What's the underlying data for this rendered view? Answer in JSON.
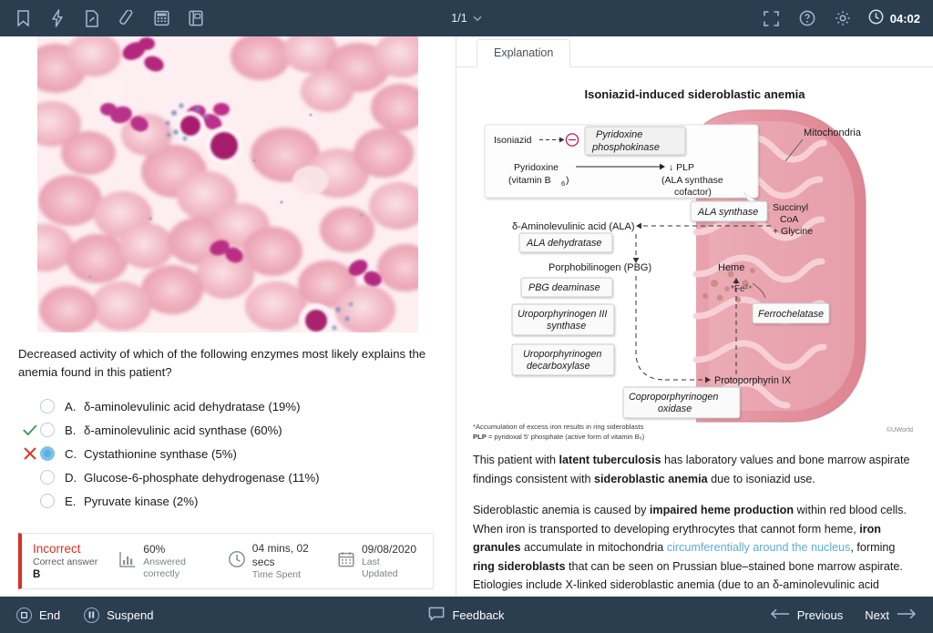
{
  "topbar": {
    "tools": [
      {
        "name": "bookmark-icon",
        "label": "Bookmark"
      },
      {
        "name": "flash-icon",
        "label": "Flash"
      },
      {
        "name": "notes-icon",
        "label": "Notes"
      },
      {
        "name": "highlighter-icon",
        "label": "Highlighter"
      },
      {
        "name": "calculator-icon",
        "label": "Calculator"
      },
      {
        "name": "lab-values-icon",
        "label": "Lab Values"
      }
    ],
    "page_indicator": "1/1",
    "right_tools": [
      {
        "name": "fullscreen-icon",
        "label": "Fullscreen"
      },
      {
        "name": "help-icon",
        "label": "Help"
      },
      {
        "name": "settings-icon",
        "label": "Settings"
      }
    ],
    "timer": "04:02"
  },
  "question": {
    "stem": "Decreased activity of which of the following enzymes most likely explains the anemia found in this patient?",
    "choices": [
      {
        "letter": "A.",
        "text": "δ-aminolevulinic acid dehydratase (19%)",
        "selected": false,
        "mark": ""
      },
      {
        "letter": "B.",
        "text": "δ-aminolevulinic acid synthase (60%)",
        "selected": false,
        "mark": "check"
      },
      {
        "letter": "C.",
        "text": "Cystathionine synthase (5%)",
        "selected": true,
        "mark": "cross"
      },
      {
        "letter": "D.",
        "text": "Glucose-6-phosphate dehydrogenase (11%)",
        "selected": false,
        "mark": ""
      },
      {
        "letter": "E.",
        "text": "Pyruvate kinase (2%)",
        "selected": false,
        "mark": ""
      }
    ]
  },
  "results": {
    "status": "Incorrect",
    "correct_answer_label": "Correct answer",
    "correct_answer": "B",
    "stats": [
      {
        "icon": "bar-chart-icon",
        "value": "60%",
        "label": "Answered correctly"
      },
      {
        "icon": "clock-icon",
        "value": "04 mins, 02 secs",
        "label": "Time Spent"
      },
      {
        "icon": "calendar-icon",
        "value": "09/08/2020",
        "label": "Last Updated"
      }
    ]
  },
  "explanation_panel": {
    "tab_label": "Explanation",
    "figure": {
      "title": "Isoniazid-induced sideroblastic anemia",
      "inset": {
        "drug": "Isoniazid",
        "inhibited_enzyme": "Pyridoxine phosphokinase",
        "substrate": "Pyridoxine",
        "substrate_sub": "(vitamin B₆)",
        "product": "↓ PLP",
        "product_sub_1": "(ALA synthase",
        "product_sub_2": "cofactor)"
      },
      "cytosol_metabolites": [
        "δ-Aminolevulinic acid (ALA)",
        "Porphobilinogen (PBG)"
      ],
      "cytosol_enzymes": [
        "ALA dehydratase",
        "PBG deaminase",
        "Uroporphyrinogen III synthase",
        "Uroporphyrinogen decarboxylase",
        "Coproporphyrinogen oxidase"
      ],
      "mito_label": "Mitochondria",
      "mito_enzymes": [
        "ALA synthase",
        "Ferrochelatase"
      ],
      "mito_substrate_1": "Succinyl",
      "mito_substrate_2": "CoA",
      "mito_substrate_3": "+ Glycine",
      "mito_metabolites": [
        "Heme",
        "Protoporphyrin IX"
      ],
      "iron_label": "*Fe²⁺",
      "footnote_1": "*Accumulation of excess iron results in ring sideroblasts",
      "footnote_2_bold": "PLP",
      "footnote_2": " = pyridoxal 5' phosphate (active form of vitamin B₆)",
      "copyright": "©UWorld"
    },
    "paragraphs": [
      {
        "runs": [
          {
            "t": "This patient with ",
            "s": "n"
          },
          {
            "t": "latent tuberculosis",
            "s": "b"
          },
          {
            "t": " has laboratory values and bone marrow aspirate findings consistent with ",
            "s": "n"
          },
          {
            "t": "sideroblastic anemia",
            "s": "b"
          },
          {
            "t": " due to isoniazid use.",
            "s": "n"
          }
        ]
      },
      {
        "runs": [
          {
            "t": "Sideroblastic anemia is caused by ",
            "s": "n"
          },
          {
            "t": "impaired heme production",
            "s": "b"
          },
          {
            "t": " within red blood cells.  When iron is transported to developing erythrocytes that cannot form heme, ",
            "s": "n"
          },
          {
            "t": "iron granules",
            "s": "b"
          },
          {
            "t": " accumulate in mitochondria ",
            "s": "n"
          },
          {
            "t": "circumferentially around the nucleus",
            "s": "h"
          },
          {
            "t": ", forming ",
            "s": "n"
          },
          {
            "t": "ring sideroblasts",
            "s": "b"
          },
          {
            "t": " that can be seen on Prussian blue–stained bone marrow aspirate.  Etiologies include X-linked sideroblastic anemia (due to an δ-aminolevulinic acid synthase mutation), myelodysplastic syndrome, alcohol use disorder, copper deficiency, and certain medications (eg, isoniazid, chloramphenicol, linezolid).",
            "s": "n"
          }
        ]
      }
    ]
  },
  "footer": {
    "end_label": "End",
    "suspend_label": "Suspend",
    "feedback_label": "Feedback",
    "previous_label": "Previous",
    "next_label": "Next"
  },
  "colors": {
    "chrome": "#2b3e50",
    "incorrect": "#d93025",
    "correct": "#3f9c4f",
    "accent_blue": "#59b0e4",
    "link_blue": "#5aacdd"
  }
}
